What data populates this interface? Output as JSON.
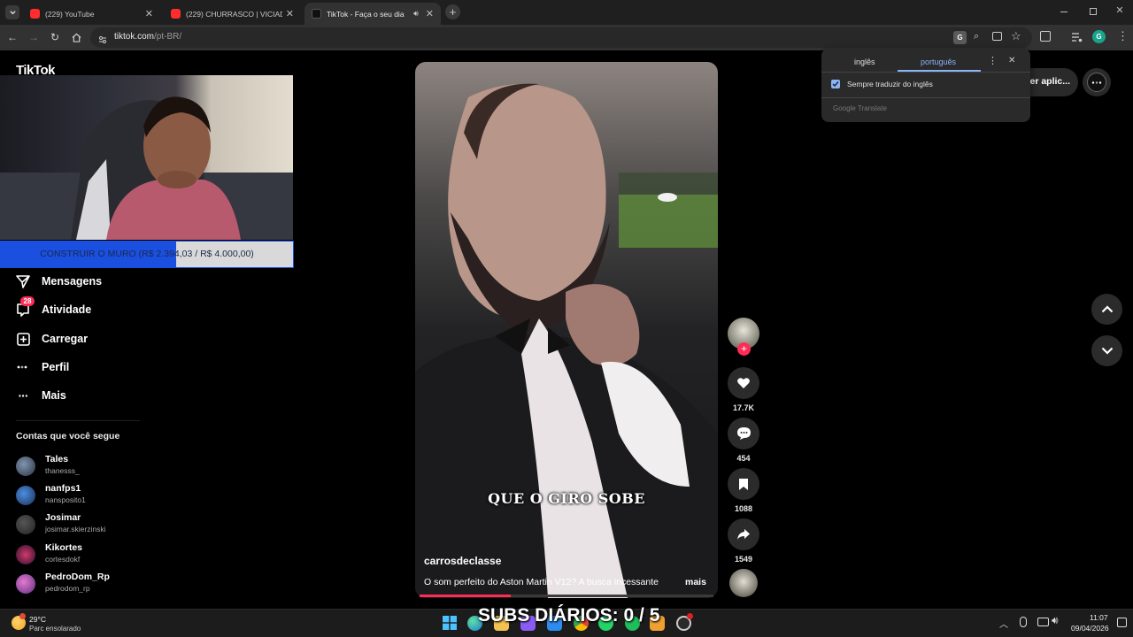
{
  "browser": {
    "tabs": [
      {
        "title": "(229) YouTube",
        "icon": "youtube-icon"
      },
      {
        "title": "(229) CHURRASCO | VICIADO E",
        "icon": "youtube-icon"
      },
      {
        "title": "TikTok - Faça o seu dia",
        "icon": "tiktok-icon"
      }
    ],
    "url_host": "tiktok.com",
    "url_path": "/pt-BR/",
    "profile_initial": "G"
  },
  "translate_popup": {
    "tab_source": "inglês",
    "tab_target": "português",
    "checkbox_label": "Sempre traduzir do inglês",
    "checkbox_checked": true,
    "footer": "Google Translate"
  },
  "tiktok": {
    "logo_text": "TikTok",
    "get_app_label": "ter aplic...",
    "overlay_goal": "CONSTRUIR O MURO (R$ 2.394,03 / R$ 4.000,00)",
    "goal_progress": 0.5985,
    "nav": [
      {
        "label": "Mensagens",
        "icon": "messages-icon"
      },
      {
        "label": "Atividade",
        "icon": "activity-icon",
        "badge": "28"
      },
      {
        "label": "Carregar",
        "icon": "upload-icon"
      },
      {
        "label": "Perfil",
        "icon": "profile-icon"
      },
      {
        "label": "Mais",
        "icon": "more-icon"
      }
    ],
    "following_heading": "Contas que você segue",
    "accounts": [
      {
        "name": "Tales",
        "handle": "thanesss_"
      },
      {
        "name": "nanfps1",
        "handle": "nansposito1"
      },
      {
        "name": "Josimar",
        "handle": "josimar.skierzinski"
      },
      {
        "name": "Kikortes",
        "handle": "cortesdokf"
      },
      {
        "name": "PedroDom_Rp",
        "handle": "pedrodom_rp"
      }
    ],
    "video": {
      "caption_overlay": "QUE O GIRO SOBE",
      "author": "carrosdeclasse",
      "description": "O som perfeito do Aston Martin V12? A busca incessante",
      "more_label": "mais",
      "likes": "17.7K",
      "comments": "454",
      "saves": "1088",
      "shares": "1549"
    }
  },
  "stream_overlay": {
    "subs_text": "SUBS DIÁRIOS: 0 / 5"
  },
  "taskbar": {
    "weather_temp": "29°C",
    "weather_desc": "Parc ensolarado",
    "time": "11:07",
    "date": "09/04/2026"
  },
  "colors": {
    "tiktok_pink": "#fe2c55",
    "translate_blue": "#8ab4f8",
    "goal_bar_fill": "#1a4fe0"
  }
}
